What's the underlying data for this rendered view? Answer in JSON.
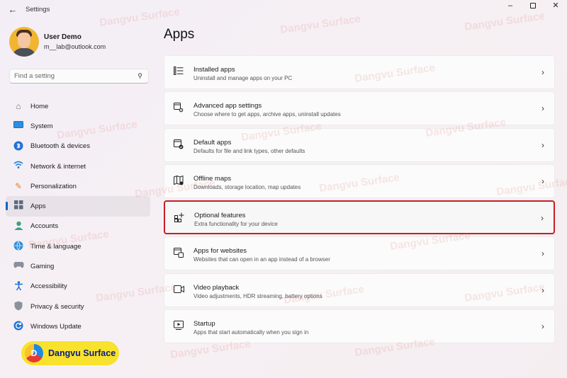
{
  "window": {
    "back_icon": "back-arrow-icon",
    "title": "Settings",
    "minimize_icon": "minimize-icon",
    "maximize_icon": "maximize-icon",
    "close_icon": "close-icon"
  },
  "profile": {
    "name": "User Demo",
    "email": "m__lab@outlook.com"
  },
  "search": {
    "placeholder": "Find a setting",
    "icon": "search-icon"
  },
  "sidebar": {
    "items": [
      {
        "label": "Home",
        "icon": "home-icon",
        "active": false
      },
      {
        "label": "System",
        "icon": "system-icon",
        "active": false
      },
      {
        "label": "Bluetooth & devices",
        "icon": "bluetooth-icon",
        "active": false
      },
      {
        "label": "Network & internet",
        "icon": "wifi-icon",
        "active": false
      },
      {
        "label": "Personalization",
        "icon": "brush-icon",
        "active": false
      },
      {
        "label": "Apps",
        "icon": "apps-icon",
        "active": true
      },
      {
        "label": "Accounts",
        "icon": "person-icon",
        "active": false
      },
      {
        "label": "Time & language",
        "icon": "globe-clock-icon",
        "active": false
      },
      {
        "label": "Gaming",
        "icon": "gamepad-icon",
        "active": false
      },
      {
        "label": "Accessibility",
        "icon": "accessibility-icon",
        "active": false
      },
      {
        "label": "Privacy & security",
        "icon": "shield-icon",
        "active": false
      },
      {
        "label": "Windows Update",
        "icon": "update-icon",
        "active": false
      }
    ]
  },
  "main": {
    "title": "Apps",
    "cards": [
      {
        "title": "Installed apps",
        "desc": "Uninstall and manage apps on your PC",
        "icon": "list-icon"
      },
      {
        "title": "Advanced app settings",
        "desc": "Choose where to get apps, archive apps, uninstall updates",
        "icon": "app-settings-icon"
      },
      {
        "title": "Default apps",
        "desc": "Defaults for file and link types, other defaults",
        "icon": "default-apps-icon"
      },
      {
        "title": "Offline maps",
        "desc": "Downloads, storage location, map updates",
        "icon": "map-icon"
      },
      {
        "title": "Optional features",
        "desc": "Extra functionality for your device",
        "icon": "add-grid-icon",
        "highlighted": true
      },
      {
        "title": "Apps for websites",
        "desc": "Websites that can open in an app instead of a browser",
        "icon": "web-apps-icon"
      },
      {
        "title": "Video playback",
        "desc": "Video adjustments, HDR streaming, battery options",
        "icon": "video-icon"
      },
      {
        "title": "Startup",
        "desc": "Apps that start automatically when you sign in",
        "icon": "startup-icon"
      }
    ]
  },
  "watermark": {
    "brand": "Dangvu Surface",
    "logo_letter": "D"
  },
  "colors": {
    "accent": "#0067c0",
    "highlight_border": "#c61f26",
    "badge": "#f8e22d"
  }
}
